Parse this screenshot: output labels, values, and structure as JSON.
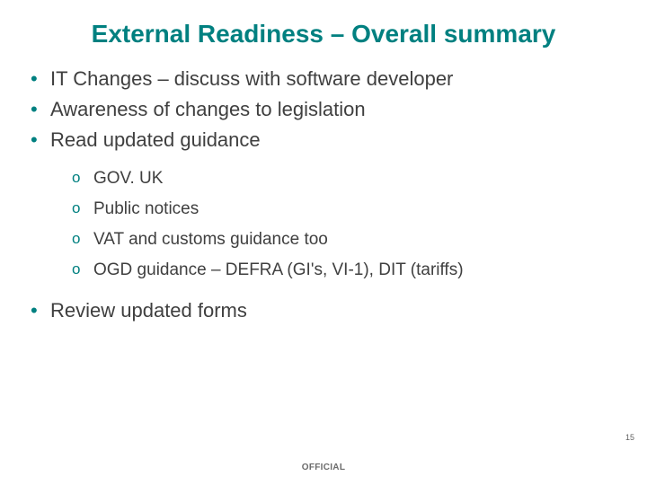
{
  "title": "External Readiness – Overall summary",
  "bullets": {
    "b0": "IT Changes – discuss with software developer",
    "b1": "Awareness of changes to legislation",
    "b2": "Read updated guidance",
    "b3": "Review updated forms"
  },
  "sub": {
    "s0": "GOV. UK",
    "s1": "Public notices",
    "s2": "VAT and customs guidance too",
    "s3": "OGD guidance – DEFRA (GI's, VI-1), DIT (tariffs)"
  },
  "pagenum": "15",
  "footer": "OFFICIAL"
}
